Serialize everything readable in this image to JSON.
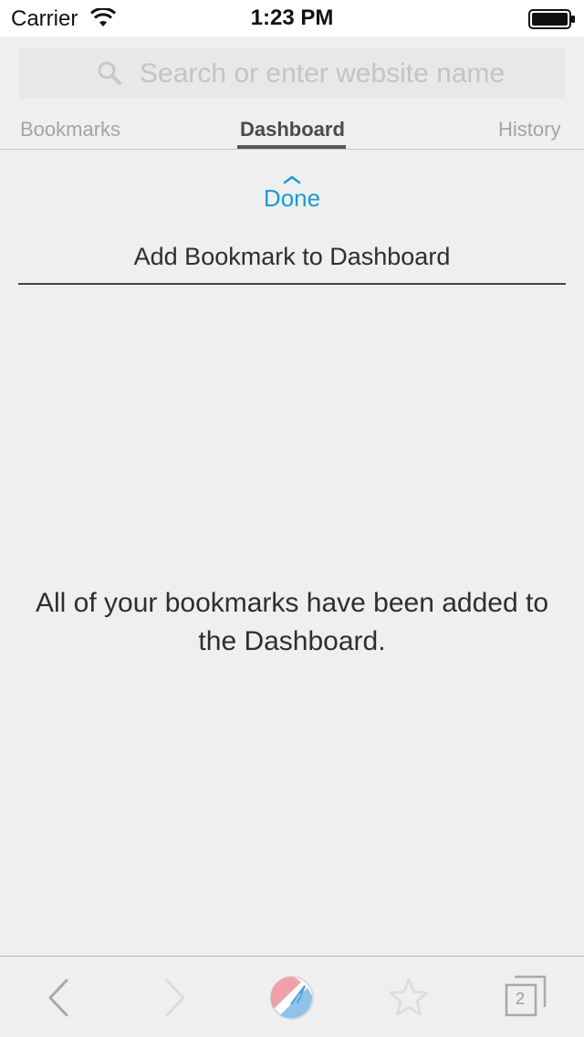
{
  "status_bar": {
    "carrier": "Carrier",
    "time": "1:23 PM"
  },
  "search": {
    "placeholder": "Search or enter website name"
  },
  "tabs": [
    {
      "label": "Bookmarks",
      "selected": false
    },
    {
      "label": "Dashboard",
      "selected": true
    },
    {
      "label": "History",
      "selected": false
    }
  ],
  "panel": {
    "done_label": "Done",
    "title": "Add Bookmark to Dashboard",
    "empty_message": "All of your bookmarks have been added to the Dashboard."
  },
  "toolbar": {
    "icons": [
      "back-icon",
      "forward-icon",
      "home-icon",
      "star-icon",
      "tabs-icon"
    ],
    "tab_count": "2"
  },
  "colors": {
    "accent": "#1a9bd7",
    "background": "#efefef"
  }
}
